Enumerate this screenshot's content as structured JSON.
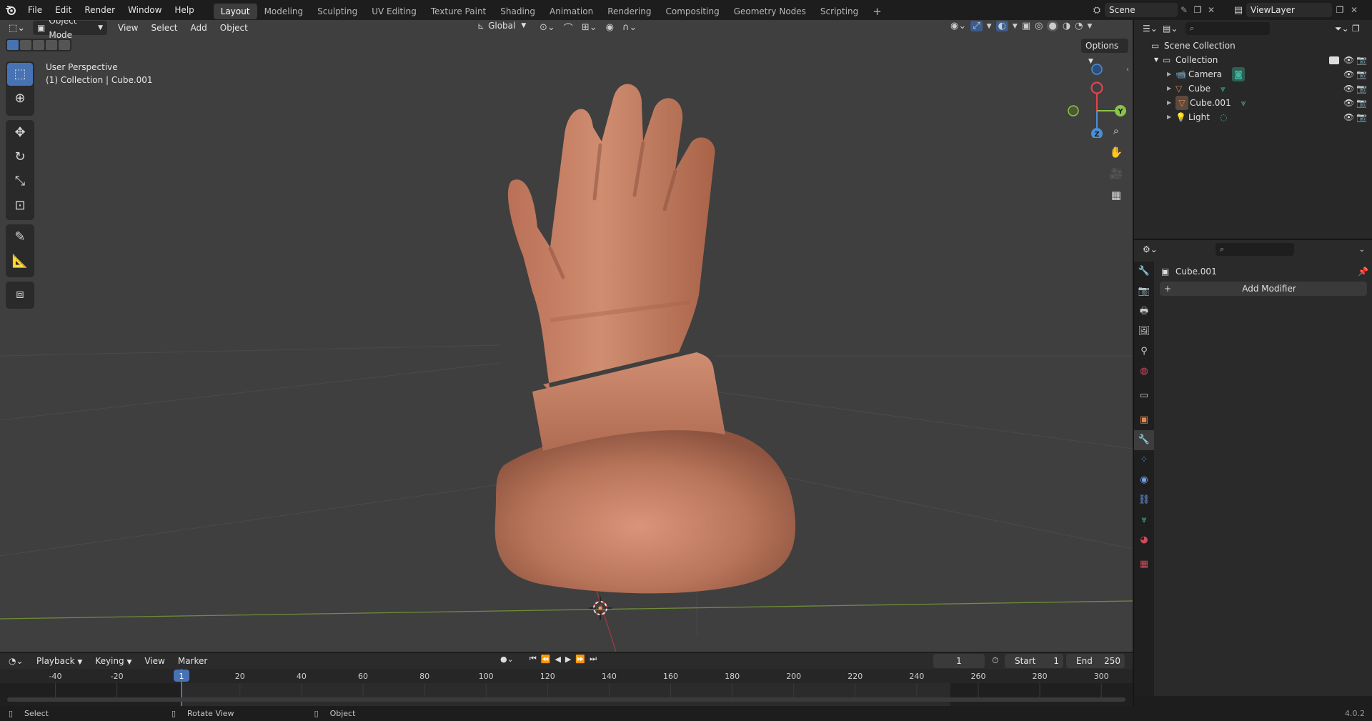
{
  "topbar": {
    "menus": [
      "File",
      "Edit",
      "Render",
      "Window",
      "Help"
    ],
    "workspaces": [
      "Layout",
      "Modeling",
      "Sculpting",
      "UV Editing",
      "Texture Paint",
      "Shading",
      "Animation",
      "Rendering",
      "Compositing",
      "Geometry Nodes",
      "Scripting"
    ],
    "active_workspace": "Layout",
    "add_tab": "+",
    "scene": "Scene",
    "view_layer": "ViewLayer"
  },
  "viewport": {
    "mode": "Object Mode",
    "menus": [
      "View",
      "Select",
      "Add",
      "Object"
    ],
    "orientation": "Global",
    "options": "Options",
    "overlay_title": "User Perspective",
    "overlay_subtitle": "(1) Collection | Cube.001",
    "gizmo": {
      "x": "X",
      "y": "Y",
      "z": "Z"
    },
    "tools": [
      "select-box-icon",
      "cursor-icon",
      "move-icon",
      "rotate-icon",
      "scale-icon",
      "transform-icon",
      "annotate-icon",
      "measure-icon",
      "add-cube-icon"
    ]
  },
  "outliner": {
    "scene_collection": "Scene Collection",
    "collection": "Collection",
    "items": [
      {
        "name": "Camera",
        "icon": "camera-icon",
        "color": "#e08850"
      },
      {
        "name": "Cube",
        "icon": "mesh-icon",
        "color": "#e08850"
      },
      {
        "name": "Cube.001",
        "icon": "mesh-icon",
        "color": "#e08850"
      },
      {
        "name": "Light",
        "icon": "light-icon",
        "color": "#e08850"
      }
    ]
  },
  "properties": {
    "object_name": "Cube.001",
    "add_modifier": "Add Modifier",
    "add_icon": "+"
  },
  "timeline": {
    "menus": [
      "Playback",
      "Keying",
      "View",
      "Marker"
    ],
    "current_frame": "1",
    "start_label": "Start",
    "start": "1",
    "end_label": "End",
    "end": "250",
    "ruler": [
      "-40",
      "-20",
      "1",
      "20",
      "40",
      "60",
      "80",
      "100",
      "120",
      "140",
      "160",
      "180",
      "200",
      "220",
      "240",
      "260",
      "280",
      "300"
    ]
  },
  "status": {
    "select": "Select",
    "rotate": "Rotate View",
    "object": "Object",
    "version": "4.0.2"
  },
  "colors": {
    "accent": "#4772b3",
    "x_axis": "#e5424f",
    "y_axis": "#8bc34a",
    "z_axis": "#4a8fd6",
    "skin": "#c88060"
  }
}
